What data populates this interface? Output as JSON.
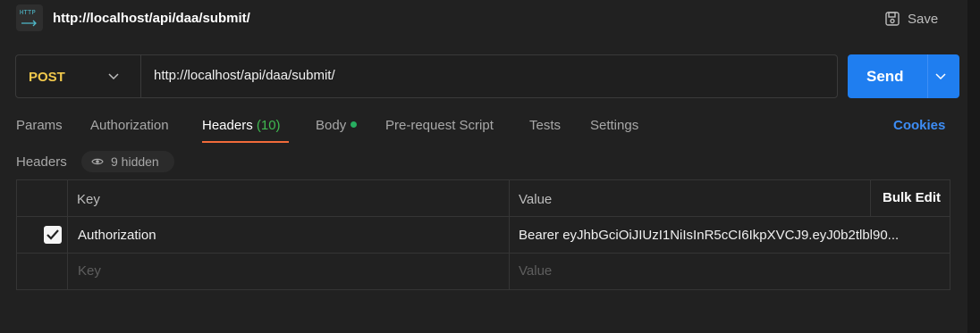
{
  "window": {
    "icon_text": "HTTP",
    "title": "http://localhost/api/daa/submit/",
    "save_label": "Save"
  },
  "request": {
    "method": "POST",
    "url": "http://localhost/api/daa/submit/",
    "send_label": "Send",
    "method_color": "#f2c94c",
    "send_color": "#1f7ef0"
  },
  "tabs": {
    "params": "Params",
    "authorization": "Authorization",
    "headers": "Headers",
    "headers_count": "(10)",
    "body": "Body",
    "pre_request": "Pre-request Script",
    "tests": "Tests",
    "settings": "Settings",
    "cookies": "Cookies",
    "active": "Headers"
  },
  "headers_section": {
    "label": "Headers",
    "hidden_label": "9 hidden",
    "columns": {
      "key": "Key",
      "value": "Value",
      "bulk_edit": "Bulk Edit"
    },
    "rows": [
      {
        "checked": true,
        "key": "Authorization",
        "value": "Bearer eyJhbGciOiJIUzI1NiIsInR5cCI6IkpXVCJ9.eyJ0b2tlbl90..."
      }
    ],
    "new_row": {
      "key_placeholder": "Key",
      "value_placeholder": "Value"
    }
  }
}
